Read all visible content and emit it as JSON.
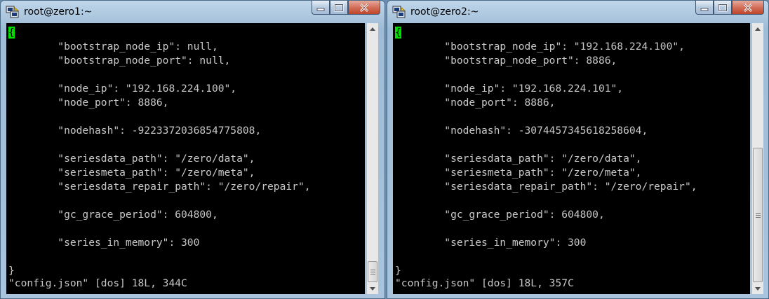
{
  "windows": [
    {
      "title": "root@zero1:~",
      "cursor_char": "{",
      "lines": [
        "",
        "        \"bootstrap_node_ip\": null,",
        "        \"bootstrap_node_port\": null,",
        "",
        "        \"node_ip\": \"192.168.224.100\",",
        "        \"node_port\": 8886,",
        "",
        "        \"nodehash\": -9223372036854775808,",
        "",
        "        \"seriesdata_path\": \"/zero/data\",",
        "        \"seriesmeta_path\": \"/zero/meta\",",
        "        \"seriesdata_repair_path\": \"/zero/repair\",",
        "",
        "        \"gc_grace_period\": 604800,",
        "",
        "        \"series_in_memory\": 300",
        "",
        "}"
      ],
      "status": "\"config.json\" [dos] 18L, 344C",
      "scroll_position": 0.95
    },
    {
      "title": "root@zero2:~",
      "cursor_char": "{",
      "lines": [
        "",
        "        \"bootstrap_node_ip\": \"192.168.224.100\",",
        "        \"bootstrap_node_port\": 8886,",
        "",
        "        \"node_ip\": \"192.168.224.101\",",
        "        \"node_port\": 8886,",
        "",
        "        \"nodehash\": -3074457345618258604,",
        "",
        "        \"seriesdata_path\": \"/zero/data\",",
        "        \"seriesmeta_path\": \"/zero/meta\",",
        "        \"seriesdata_repair_path\": \"/zero/repair\",",
        "",
        "        \"gc_grace_period\": 604800,",
        "",
        "        \"series_in_memory\": 300",
        "",
        "}"
      ],
      "status": "\"config.json\" [dos] 18L, 357C",
      "scroll_position": 0.6
    }
  ],
  "icons": {
    "app": "putty-icon",
    "minimize": "minimize-icon",
    "maximize": "maximize-icon",
    "close": "close-icon",
    "scroll_up": "arrow-up-icon",
    "scroll_down": "arrow-down-icon"
  },
  "colors": {
    "terminal_bg": "#000000",
    "terminal_fg": "#c7c7c7",
    "cursor": "#00e000"
  }
}
